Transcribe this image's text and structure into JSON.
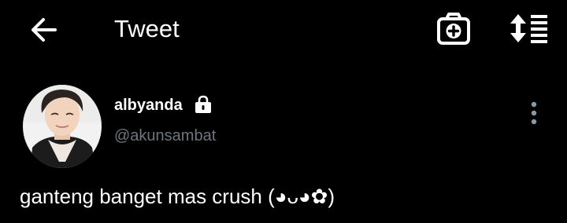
{
  "header": {
    "title": "Tweet",
    "back_icon": "arrow-left-icon",
    "camera_icon": "camera-plus-icon",
    "sort_icon": "sort-list-icon"
  },
  "tweet": {
    "author": {
      "display_name": "albyanda",
      "handle": "@akunsambat",
      "protected_icon": "lock-icon",
      "avatar_icon": "avatar-photo"
    },
    "text": "ganteng banget mas crush (◕ᴗ◕✿)",
    "more_icon": "more-vertical-icon"
  },
  "colors": {
    "background": "#000000",
    "text_primary": "#ffffff",
    "text_secondary": "#6e767d",
    "more_icon": "#8b98a5"
  }
}
